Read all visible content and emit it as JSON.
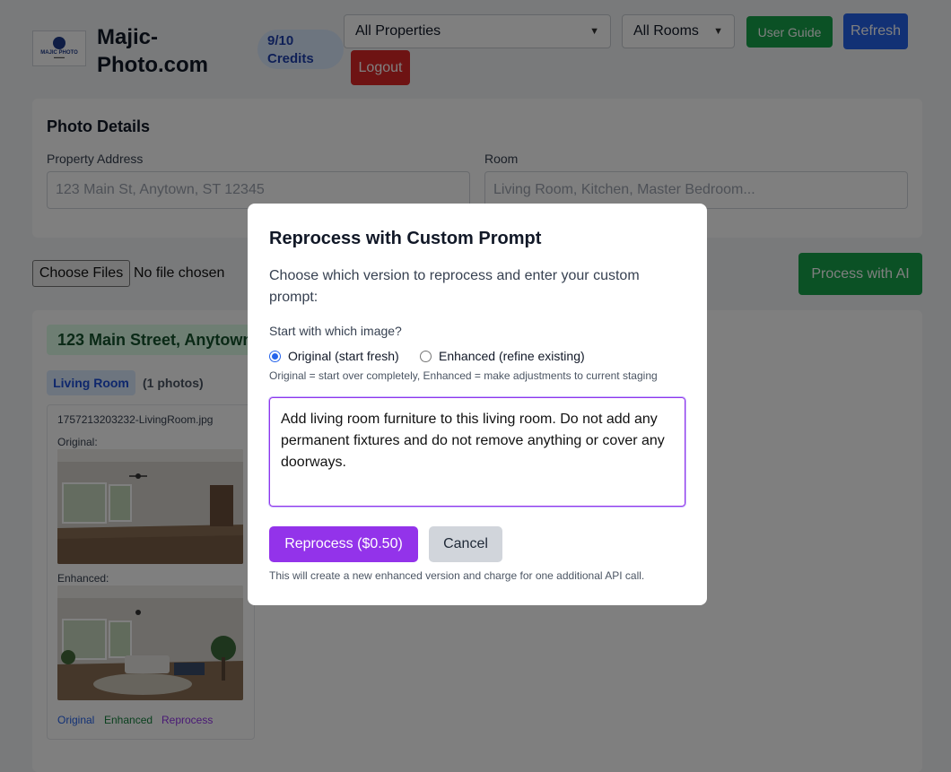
{
  "header": {
    "logo_text": "MAJIC PHOTO",
    "brand": "Majic-Photo.com",
    "credits": "9/10 Credits",
    "properties_select": "All Properties",
    "rooms_select": "All Rooms",
    "user_guide": "User Guide",
    "refresh": "Refresh",
    "logout": "Logout"
  },
  "details": {
    "title": "Photo Details",
    "address_label": "Property Address",
    "address_placeholder": "123 Main St, Anytown, ST 12345",
    "room_label": "Room",
    "room_placeholder": "Living Room, Kitchen, Master Bedroom..."
  },
  "upload": {
    "choose": "Choose Files",
    "status": "No file chosen",
    "process": "Process with AI"
  },
  "property": {
    "heading": "123 Main Street, Anytown",
    "room_tag": "Living Room",
    "count": "(1 photos)",
    "photo": {
      "filename": "1757213203232-LivingRoom.jpg",
      "original_label": "Original:",
      "enhanced_label": "Enhanced:",
      "links": [
        "Original",
        "Enhanced",
        "Reprocess"
      ]
    }
  },
  "modal": {
    "title": "Reprocess with Custom Prompt",
    "description": "Choose which version to reprocess and enter your custom prompt:",
    "start_label": "Start with which image?",
    "option_original": "Original (start fresh)",
    "option_enhanced": "Enhanced (refine existing)",
    "selected": "original",
    "hint": "Original = start over completely, Enhanced = make adjustments to current staging",
    "prompt": "Add living room furniture to this living room.  Do not add any permanent fixtures and do not remove anything or cover any doorways.",
    "reprocess": "Reprocess ($0.50)",
    "cancel": "Cancel",
    "footer": "This will create a new enhanced version and charge for one additional API call."
  },
  "colors": {
    "green": "#16a34a",
    "blue": "#2563eb",
    "red": "#dc2626",
    "purple": "#9333ea"
  }
}
